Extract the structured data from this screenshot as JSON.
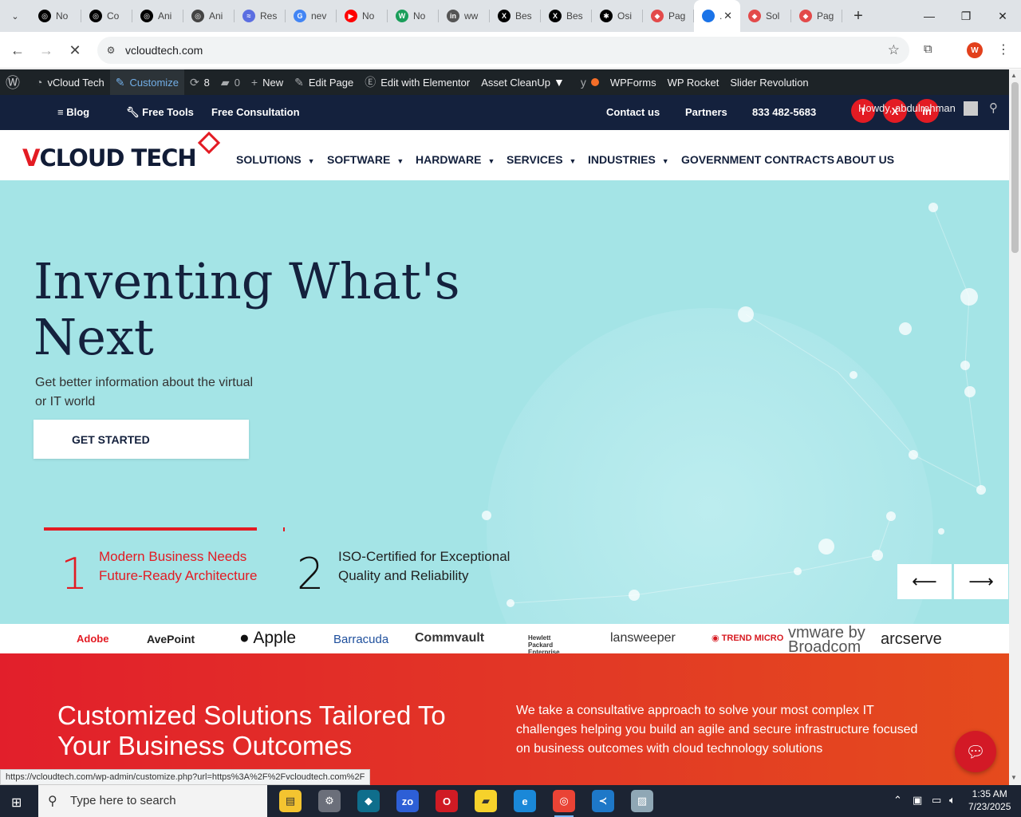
{
  "browser": {
    "tabs": [
      {
        "label": "No",
        "color": "#000000",
        "glyph": "◎"
      },
      {
        "label": "Co",
        "color": "#000000",
        "glyph": "◎"
      },
      {
        "label": "Ani",
        "color": "#000000",
        "glyph": "◎"
      },
      {
        "label": "Ani",
        "color": "#444444",
        "glyph": "◎"
      },
      {
        "label": "Res",
        "color": "#5b6ee1",
        "glyph": "≈"
      },
      {
        "label": "nev",
        "color": "#4285f4",
        "glyph": "G"
      },
      {
        "label": "No",
        "color": "#ff0000",
        "glyph": "▶"
      },
      {
        "label": "No",
        "color": "#1a9e5a",
        "glyph": "W"
      },
      {
        "label": "ww",
        "color": "#555555",
        "glyph": "in"
      },
      {
        "label": "Bes",
        "color": "#000000",
        "glyph": "X"
      },
      {
        "label": "Bes",
        "color": "#000000",
        "glyph": "X"
      },
      {
        "label": "Osi",
        "color": "#000000",
        "glyph": "✱"
      },
      {
        "label": "Pag",
        "color": "#e34a4a",
        "glyph": "◆"
      },
      {
        "label": ".",
        "color": "#1a73e8",
        "glyph": "",
        "active": true
      },
      {
        "label": "Sol",
        "color": "#e34a4a",
        "glyph": "◆"
      },
      {
        "label": "Pag",
        "color": "#e34a4a",
        "glyph": "◆"
      }
    ],
    "url": "vcloudtech.com",
    "profile_initial": "W",
    "status_url": "https://vcloudtech.com/wp-admin/customize.php?url=https%3A%2F%2Fvcloudtech.com%2F"
  },
  "wp_admin_bar": {
    "site_name": "vCloud Tech",
    "customize": "Customize",
    "updates_count": "8",
    "comments_count": "0",
    "new": "New",
    "edit_page": "Edit Page",
    "edit_elementor": "Edit with Elementor",
    "asset_cleanup": "Asset CleanUp",
    "wpforms": "WPForms",
    "wp_rocket": "WP Rocket",
    "slider_revolution": "Slider Revolution",
    "howdy": "Howdy, abdulrehman"
  },
  "topbar": {
    "blog": "Blog",
    "free_tools": "Free Tools",
    "free_consultation": "Free Consultation",
    "contact": "Contact us",
    "partners": "Partners",
    "phone": "833 482-5683",
    "social": [
      "f",
      "X",
      "in"
    ]
  },
  "logo": {
    "v": "V",
    "rest": "CLOUD TECH"
  },
  "nav": [
    {
      "label": "SOLUTIONS",
      "caret": true
    },
    {
      "label": "SOFTWARE",
      "caret": true
    },
    {
      "label": "HARDWARE",
      "caret": true
    },
    {
      "label": "SERVICES",
      "caret": true
    },
    {
      "label": "INDUSTRIES",
      "caret": true
    },
    {
      "label": "GOVERNMENT CONTRACTS",
      "caret": false
    },
    {
      "label": "ABOUT US",
      "caret": false
    }
  ],
  "hero": {
    "title_line1": "Inventing What's",
    "title_line2": "Next",
    "subtitle": "Get better information about the virtual or IT world",
    "cta": "GET STARTED",
    "slides": [
      {
        "num": "1",
        "text": "Modern Business Needs Future-Ready Architecture",
        "color": "#e31b23"
      },
      {
        "num": "2",
        "text": "ISO-Certified for Exceptional Quality and Reliability",
        "color": "#111111"
      }
    ],
    "prev_arrow": "⟵",
    "next_arrow": "⟶",
    "progress_fraction": 1.0
  },
  "brands": [
    "Adobe",
    "AvePoint",
    "Apple",
    "Barracuda",
    "Commvault",
    "Hewlett Packard Enterprise",
    "lansweeper",
    "TREND MICRO",
    "vmware by Broadcom",
    "arcserve"
  ],
  "section": {
    "title": "Customized Solutions Tailored To Your Business Outcomes",
    "text": "We take a consultative approach to solve your most complex IT challenges helping you build an agile and secure infrastructure focused on business outcomes with cloud technology solutions"
  },
  "taskbar": {
    "search_placeholder": "Type here to search",
    "time": "1:35 AM",
    "date": "7/23/2025"
  }
}
